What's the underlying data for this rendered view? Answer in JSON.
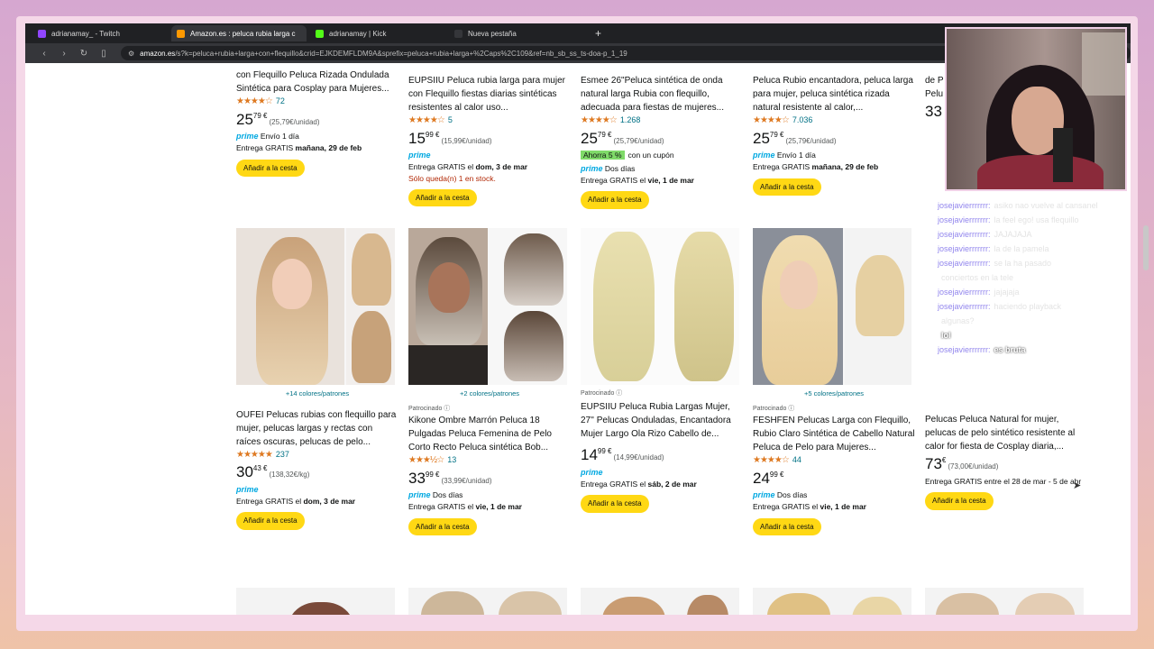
{
  "tabs": [
    {
      "label": "adrianamay_ - Twitch",
      "color": "#9146ff",
      "active": false
    },
    {
      "label": "Amazon.es : peluca rubia larga c",
      "color": "#ff9900",
      "active": true
    },
    {
      "label": "adrianamay | Kick",
      "color": "#53fc18",
      "active": false
    },
    {
      "label": "Nueva pestaña",
      "color": "#35363a",
      "active": false
    }
  ],
  "new_tab_label": "+",
  "url": {
    "domain": "amazon.es",
    "path": "/s?k=peluca+rubia+larga+con+flequillo&crid=EJKDEMFLDM9A&sprefix=peluca+rubia+larga+%2Caps%2C109&ref=nb_sb_ss_ts-doa-p_1_19"
  },
  "row1": [
    {
      "title": "con Flequillo Peluca Rizada Ondulada Sintética para Cosplay para Mujeres...",
      "stars": "★★★★☆",
      "reviews": "72",
      "price_int": "25",
      "price_dec": "79 €",
      "unit": "(25,79€/unidad)",
      "prime": "prime",
      "delivery_prefix": "Envío 1 día",
      "delivery2_text": "Entrega GRATIS ",
      "delivery2_bold": "mañana, 29 de feb",
      "button": "Añadir a la cesta"
    },
    {
      "title": "EUPSIIU Peluca rubia larga para mujer con Flequillo fiestas diarias sintéticas resistentes al calor uso...",
      "stars": "★★★★☆",
      "reviews": "5",
      "price_int": "15",
      "price_dec": "99 €",
      "unit": "(15,99€/unidad)",
      "prime": "prime",
      "delivery2_text": "Entrega GRATIS el ",
      "delivery2_bold": "dom, 3 de mar",
      "stock": "Sólo queda(n) 1 en stock.",
      "button": "Añadir a la cesta"
    },
    {
      "title": "Esmee 26\"Peluca sintética de onda natural larga Rubia con flequillo, adecuada para fiestas de mujeres...",
      "stars": "★★★★☆",
      "reviews": "1.268",
      "price_int": "25",
      "price_dec": "79 €",
      "unit": "(25,79€/unidad)",
      "badge": "Ahorra 5 %",
      "coupon": "con un cupón",
      "prime": "prime",
      "delivery_prefix": "Dos días",
      "delivery2_text": "Entrega GRATIS el ",
      "delivery2_bold": "vie, 1 de mar",
      "button": "Añadir a la cesta"
    },
    {
      "title": "Peluca Rubio encantadora, peluca larga para mujer, peluca sintética rizada natural resistente al calor,...",
      "stars": "★★★★☆",
      "reviews": "7.036",
      "price_int": "25",
      "price_dec": "79 €",
      "unit": "(25,79€/unidad)",
      "prime": "prime",
      "delivery_prefix": "Envío 1 día",
      "delivery2_text": "Entrega GRATIS ",
      "delivery2_bold": "mañana, 29 de feb",
      "button": "Añadir a la cesta"
    }
  ],
  "row2": [
    {
      "colors": "+14 colores/patrones",
      "title": "OUFEI Pelucas rubias con flequillo para mujer, pelucas largas y rectas con raíces oscuras, pelucas de pelo...",
      "stars": "★★★★★",
      "reviews": "237",
      "price_int": "30",
      "price_dec": "43 €",
      "unit": "(138,32€/kg)",
      "prime": "prime",
      "delivery2_text": "Entrega GRATIS el ",
      "delivery2_bold": "dom, 3 de mar",
      "button": "Añadir a la cesta"
    },
    {
      "colors": "+2 colores/patrones",
      "sponsored": "Patrocinado ⓘ",
      "title": "Kikone Ombre Marrón Peluca 18 Pulgadas Peluca Femenina de Pelo Corto Recto Peluca sintética Bob...",
      "stars": "★★★½☆",
      "reviews": "13",
      "price_int": "33",
      "price_dec": "99 €",
      "unit": "(33,99€/unidad)",
      "prime": "prime",
      "delivery_prefix": "Dos días",
      "delivery2_text": "Entrega GRATIS el ",
      "delivery2_bold": "vie, 1 de mar",
      "button": "Añadir a la cesta"
    },
    {
      "sponsored": "Patrocinado ⓘ",
      "title": "EUPSIIU Peluca Rubia Largas Mujer, 27'' Pelucas Onduladas, Encantadora Mujer Largo Ola Rizo Cabello de...",
      "price_int": "14",
      "price_dec": "99 €",
      "unit": "(14,99€/unidad)",
      "prime": "prime",
      "delivery2_text": "Entrega GRATIS el ",
      "delivery2_bold": "sáb, 2 de mar",
      "button": "Añadir a la cesta"
    },
    {
      "colors": "+5 colores/patrones",
      "sponsored": "Patrocinado ⓘ",
      "title": "FESHFEN Pelucas Larga con Flequillo, Rubio Claro Sintética de Cabello Natural Peluca de Pelo para Mujeres...",
      "stars": "★★★★☆",
      "reviews": "44",
      "price_int": "24",
      "price_dec": "99 €",
      "prime": "prime",
      "delivery_prefix": "Dos días",
      "delivery2_text": "Entrega GRATIS el ",
      "delivery2_bold": "vie, 1 de mar",
      "button": "Añadir a la cesta"
    }
  ],
  "partial_col": {
    "top_text1": "de P",
    "top_text2": "Pelu",
    "top_price": "33",
    "title": "Pelucas Peluca Natural for mujer, pelucas de pelo sintético resistente al calor for fiesta de Cosplay diaria,...",
    "price_int": "73",
    "price_dec": "€",
    "unit": "(73,00€/unidad)",
    "delivery": "Entrega GRATIS entre el 28 de mar - 5 de abr",
    "button": "Añadir a la cesta"
  },
  "chat": [
    {
      "user": "josejavierrrrrrr:",
      "msg": "asiko nao vuelve al cansanel",
      "bright": false
    },
    {
      "user": "josejavierrrrrrr:",
      "msg": "la feel ego! usa flequillo",
      "bright": false
    },
    {
      "user": "josejavierrrrrrr:",
      "msg": "JAJAJAJA",
      "bright": false
    },
    {
      "user": "josejavierrrrrrr:",
      "msg": "la de la pamela",
      "bright": false
    },
    {
      "user": "josejavierrrrrrr:",
      "msg": "se la ha pasado",
      "bright": false
    },
    {
      "user": "",
      "msg": "conciertos en la tele",
      "bright": false
    },
    {
      "user": "josejavierrrrrrr:",
      "msg": "jajajaja",
      "bright": false
    },
    {
      "user": "josejavierrrrrrr:",
      "msg": "haciendo playback",
      "bright": false
    },
    {
      "user": "",
      "msg": "algunas?",
      "bright": false
    },
    {
      "user": "",
      "msg": "lol",
      "bright": true
    },
    {
      "user": "josejavierrrrrrr:",
      "msg": "es bruta",
      "bright": true
    }
  ]
}
